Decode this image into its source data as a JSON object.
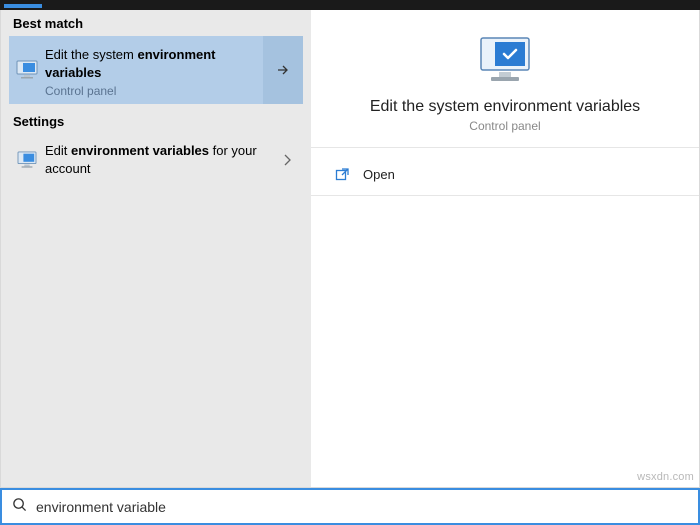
{
  "left": {
    "best_match_header": "Best match",
    "best_match": {
      "title_pre": "Edit the system ",
      "title_bold": "environment variables",
      "subtitle": "Control panel"
    },
    "settings_header": "Settings",
    "settings_item": {
      "pre": "Edit ",
      "bold": "environment variables",
      "post": " for your account"
    }
  },
  "right": {
    "title": "Edit the system environment variables",
    "subtitle": "Control panel",
    "actions": {
      "open": "Open"
    }
  },
  "search": {
    "value": "environment variable"
  },
  "watermark": "wsxdn.com"
}
